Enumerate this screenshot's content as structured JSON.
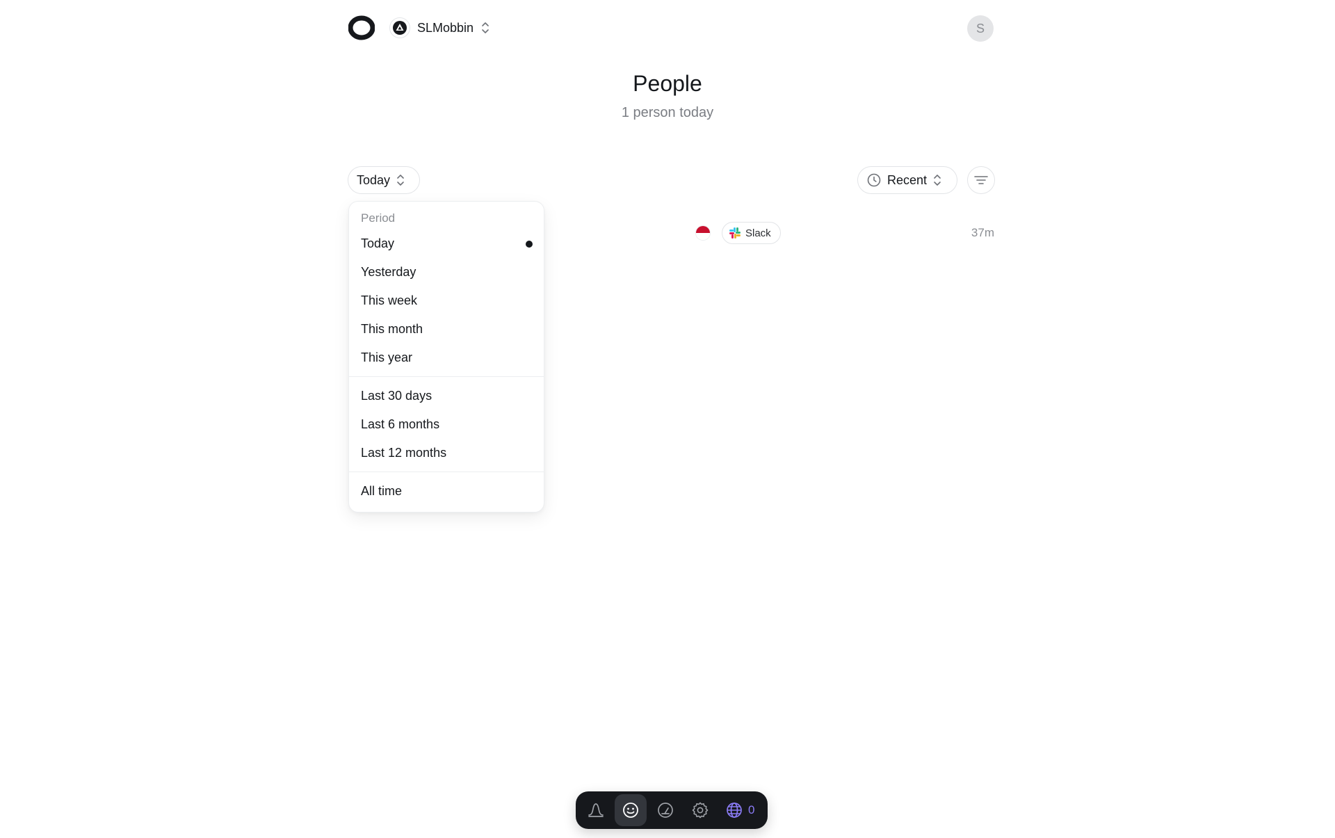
{
  "header": {
    "workspace_name": "SLMobbin",
    "user_initial": "S",
    "logo_icon": "ring-logo-icon",
    "workspace_icon": "triangle-icon"
  },
  "main": {
    "title": "People",
    "subtitle": "1 person today"
  },
  "toolbar": {
    "period_label": "Today",
    "sort_label": "Recent",
    "filter_icon": "filter-lines-icon"
  },
  "dropdown": {
    "section_label": "Period",
    "selected": "Today",
    "groups": [
      [
        "Today",
        "Yesterday",
        "This week",
        "This month",
        "This year"
      ],
      [
        "Last 30 days",
        "Last 6 months",
        "Last 12 months"
      ],
      [
        "All time"
      ]
    ]
  },
  "row": {
    "source": "Slack",
    "time": "37m",
    "flag_colors": [
      "#c8102e",
      "#ffffff"
    ]
  },
  "bottom_nav": {
    "items": [
      "bell-icon",
      "smile-icon",
      "gauge-icon",
      "gear-icon",
      "globe-icon"
    ],
    "active": "smile-icon",
    "online_count": "0",
    "accent": "#8b7cf6"
  }
}
